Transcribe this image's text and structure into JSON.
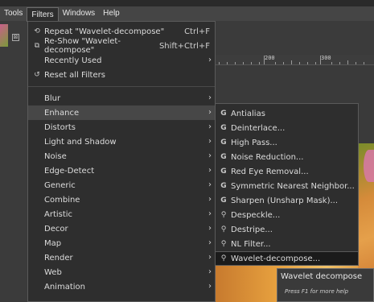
{
  "menubar": {
    "items": [
      "Tools",
      "Filters",
      "Windows",
      "Help"
    ]
  },
  "tab": {
    "close_glyph": "⊠"
  },
  "ruler": {
    "labels": [
      "200",
      "300"
    ]
  },
  "filters_menu": {
    "top": [
      {
        "label": "Repeat \"Wavelet-decompose\"",
        "accel": "Ctrl+F",
        "icon": "repeat-icon"
      },
      {
        "label": "Re-Show \"Wavelet-decompose\"",
        "accel": "Shift+Ctrl+F",
        "icon": "reshow-icon"
      },
      {
        "label": "Recently Used",
        "arrow": "›"
      },
      {
        "label": "Reset all Filters",
        "icon": "reset-icon"
      }
    ],
    "submenus": [
      "Blur",
      "Enhance",
      "Distorts",
      "Light and Shadow",
      "Noise",
      "Edge-Detect",
      "Generic",
      "Combine",
      "Artistic",
      "Decor",
      "Map",
      "Render",
      "Web",
      "Animation"
    ],
    "highlighted": "Enhance"
  },
  "enhance_menu": {
    "items": [
      {
        "label": "Antialias",
        "icon": "gegl-icon"
      },
      {
        "label": "Deinterlace...",
        "icon": "gegl-icon"
      },
      {
        "label": "High Pass...",
        "icon": "gegl-icon"
      },
      {
        "label": "Noise Reduction...",
        "icon": "gegl-icon"
      },
      {
        "label": "Red Eye Removal...",
        "icon": "gegl-icon"
      },
      {
        "label": "Symmetric Nearest Neighbor...",
        "icon": "gegl-icon"
      },
      {
        "label": "Sharpen (Unsharp Mask)...",
        "icon": "gegl-icon"
      },
      {
        "label": "Despeckle...",
        "icon": "plugin-icon"
      },
      {
        "label": "Destripe...",
        "icon": "plugin-icon"
      },
      {
        "label": "NL Filter...",
        "icon": "plugin-icon"
      },
      {
        "label": "Wavelet-decompose...",
        "icon": "plugin-icon"
      }
    ],
    "selected": "Wavelet-decompose..."
  },
  "tooltip": {
    "title": "Wavelet decompose",
    "help": "Press F1 for more help"
  }
}
